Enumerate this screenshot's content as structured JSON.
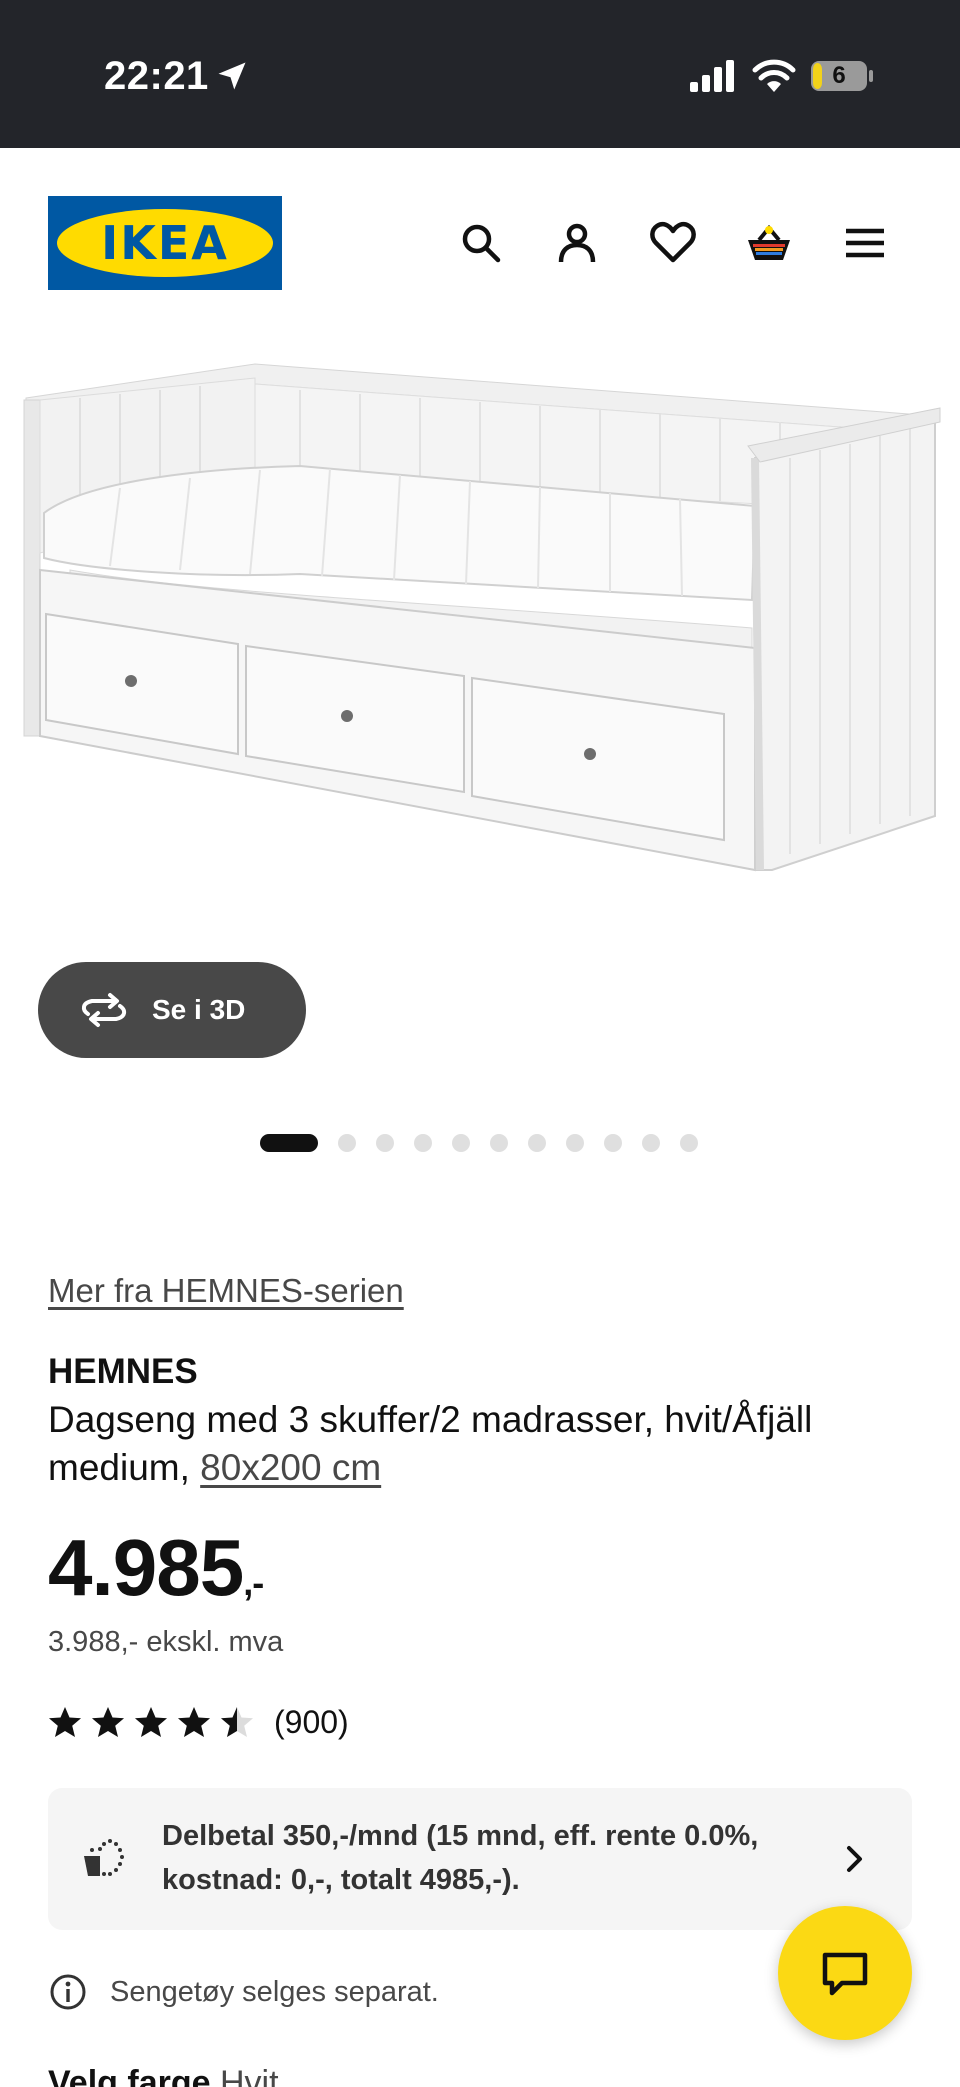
{
  "status_bar": {
    "time": "22:21",
    "battery_level": "6",
    "icons": [
      "location-arrow-icon",
      "cell-signal-icon",
      "wifi-icon",
      "battery-icon"
    ]
  },
  "header": {
    "logo_text": "IKEA",
    "brand_colors": {
      "blue": "#0058a3",
      "yellow": "#ffdb00"
    },
    "icons": [
      "search-icon",
      "profile-icon",
      "heart-icon",
      "basket-icon",
      "menu-icon"
    ]
  },
  "gallery": {
    "view_3d_label": "Se i 3D",
    "slide_count": 11,
    "active_slide": 1
  },
  "product": {
    "series_link": "Mer fra HEMNES-serien",
    "name": "HEMNES",
    "description": "Dagseng med 3 skuffer/2 madrasser, hvit/Åfjäll medium,",
    "size_link": "80x200 cm",
    "price": "4.985",
    "price_suffix": ",-",
    "price_ex_vat": "3.988,- ekskl. mva",
    "rating_value": 4.5,
    "rating_max": 5,
    "rating_count": "(900)"
  },
  "installment": {
    "text": "Delbetal 350,-/mnd (15 mnd, eff. rente 0.0%, kostnad: 0,-, totalt 4985,-)."
  },
  "notice": {
    "text": "Sengetøy selges separat."
  },
  "partial_section": {
    "label": "Velg farge",
    "value": "Hvit"
  },
  "chat": {
    "color": "#fbd914",
    "icon": "chat-bubble-icon"
  }
}
